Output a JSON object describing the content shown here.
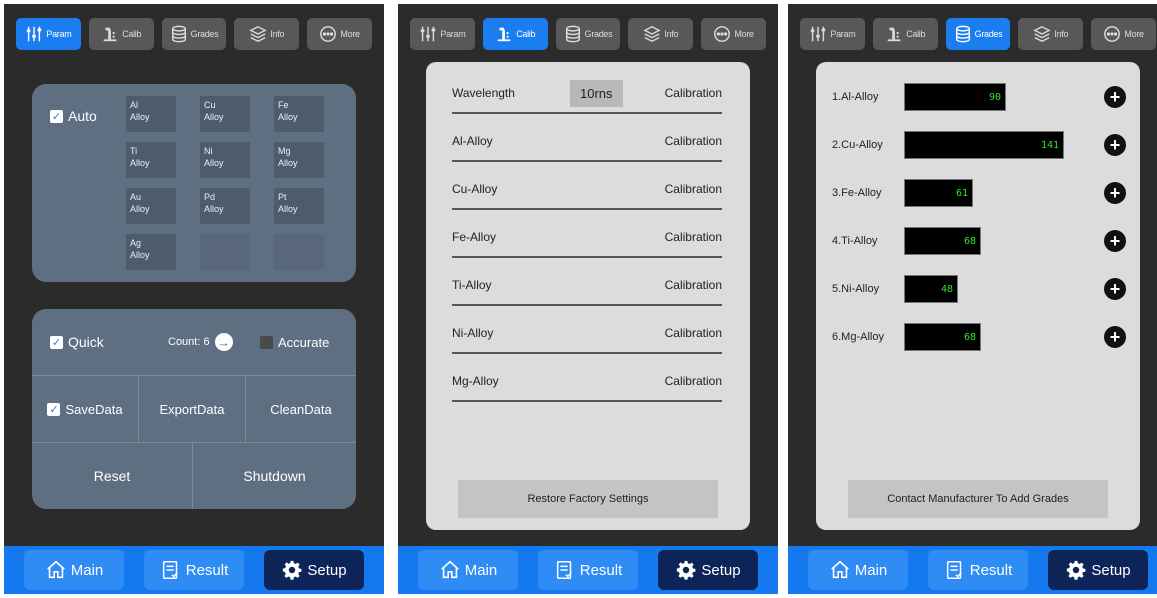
{
  "tabs": [
    {
      "label": "Param",
      "icon": "sliders-icon"
    },
    {
      "label": "Calib",
      "icon": "calibrate-icon"
    },
    {
      "label": "Grades",
      "icon": "database-icon"
    },
    {
      "label": "Info",
      "icon": "layers-icon"
    },
    {
      "label": "More",
      "icon": "more-circle-icon"
    }
  ],
  "nav": {
    "main": "Main",
    "result": "Result",
    "setup": "Setup"
  },
  "colors": {
    "accent": "#1a7ef0",
    "navbar": "#1479ee",
    "active_nav": "#0d2458",
    "bar_text": "#2fe52f"
  },
  "param": {
    "auto_label": "Auto",
    "alloys": [
      "Al\nAlloy",
      "Cu\nAlloy",
      "Fe\nAlloy",
      "Ti\nAlloy",
      "Ni\nAlloy",
      "Mg\nAlloy",
      "Au\nAlloy",
      "Pd\nAlloy",
      "Pt\nAlloy",
      "Ag\nAlloy",
      "",
      ""
    ],
    "quick_label": "Quick",
    "count_label": "Count: 6",
    "accurate_label": "Accurate",
    "savedata_label": "SaveData",
    "exportdata_label": "ExportData",
    "cleandata_label": "CleanData",
    "reset_label": "Reset",
    "shutdown_label": "Shutdown"
  },
  "calib": {
    "wavelength_label": "Wavelength",
    "wavelength_value": "10rns",
    "rows": [
      "Al-Alloy",
      "Cu-Alloy",
      "Fe-Alloy",
      "Ti-Alloy",
      "Ni-Alloy",
      "Mg-Alloy"
    ],
    "calibration_label": "Calibration",
    "restore_label": "Restore Factory Settings"
  },
  "grades": {
    "rows": [
      {
        "label": "1.Al-Alloy",
        "value": 90
      },
      {
        "label": "2.Cu-Alloy",
        "value": 141
      },
      {
        "label": "3.Fe-Alloy",
        "value": 61
      },
      {
        "label": "4.Ti-Alloy",
        "value": 68
      },
      {
        "label": "5.Ni-Alloy",
        "value": 48
      },
      {
        "label": "6.Mg-Alloy",
        "value": 68
      }
    ],
    "contact_label": "Contact Manufacturer To Add Grades"
  }
}
